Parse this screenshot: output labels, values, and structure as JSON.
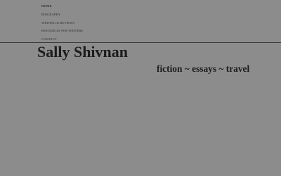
{
  "nav": {
    "items": [
      {
        "label": "HOME",
        "active": true
      },
      {
        "label": "BIOGRAPHY",
        "active": false
      },
      {
        "label": "WRITING & REVIEWS",
        "active": false
      },
      {
        "label": "RESOURCES FOR WRITERS",
        "active": false
      },
      {
        "label": "CONTACT",
        "active": false
      }
    ]
  },
  "header": {
    "site_title": "Sally Shivnan",
    "tagline": "fiction ~ essays ~ travel"
  },
  "colors": {
    "background": "#8c8c8c",
    "text": "#1c1c1c",
    "active_nav": "#3b2b3f"
  }
}
